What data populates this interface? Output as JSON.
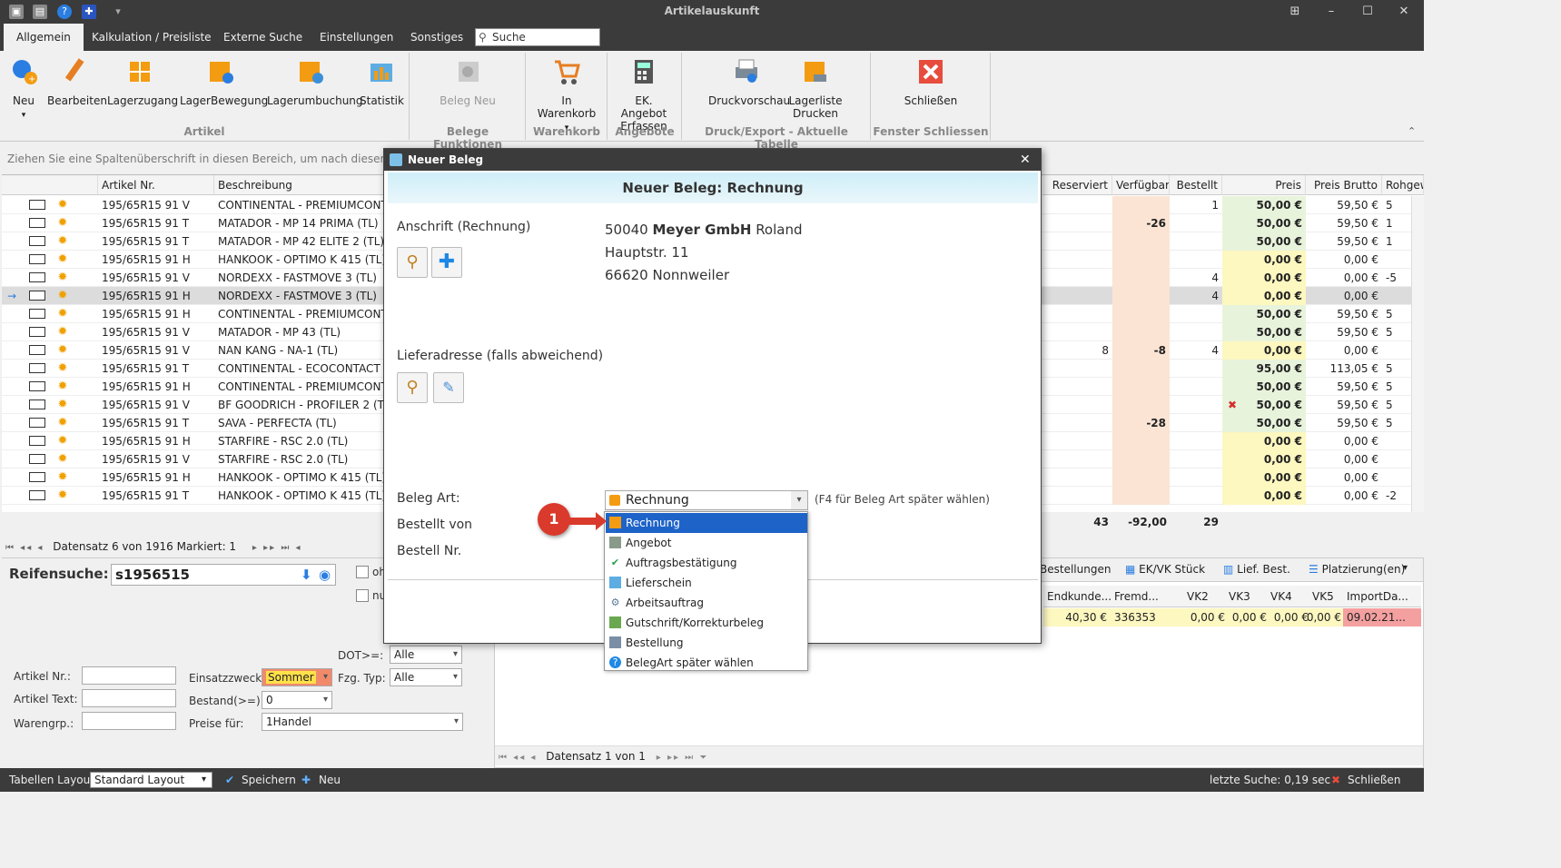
{
  "window": {
    "title": "Artikelauskunft"
  },
  "tabs": [
    "Allgemein",
    "Kalkulation / Preisliste",
    "Externe Suche",
    "Einstellungen",
    "Sonstiges"
  ],
  "search": {
    "label": "Suche"
  },
  "ribbon": {
    "buttons": [
      {
        "label": "Neu"
      },
      {
        "label": "Bearbeiten"
      },
      {
        "label": "Lagerzugang"
      },
      {
        "label": "LagerBewegung"
      },
      {
        "label": "Lagerumbuchung"
      },
      {
        "label": "Statistik"
      },
      {
        "label": "Beleg Neu"
      },
      {
        "label": "In Warenkorb"
      },
      {
        "label": "EK. Angebot Erfassen"
      },
      {
        "label": "Druckvorschau"
      },
      {
        "label": "Lagerliste Drucken"
      },
      {
        "label": "Schließen"
      }
    ],
    "groups": [
      "Artikel",
      "Belege Funktionen",
      "Warenkorb",
      "Angebote",
      "Druck/Export - Aktuelle Tabelle",
      "Fenster Schliessen"
    ]
  },
  "group_hint": "Ziehen Sie eine Spaltenüberschrift in diesen Bereich, um nach dieser zu gruppieren",
  "grid": {
    "columns": [
      "Artikel Nr.",
      "Beschreibung",
      "Reserviert",
      "Verfügbar",
      "Bestellt",
      "Preis",
      "Preis Brutto",
      "Rohgew"
    ],
    "rows": [
      {
        "nr": "195/65R15 91 V",
        "desc": "CONTINENTAL - PREMIUMCONTACT 6",
        "res": "",
        "verf": "",
        "best": "1",
        "preis": "50,00 €",
        "brutto": "59,50 €",
        "roh": "5"
      },
      {
        "nr": "195/65R15 91 T",
        "desc": "MATADOR - MP 14 PRIMA (TL)",
        "res": "",
        "verf": "-26",
        "best": "",
        "preis": "50,00 €",
        "brutto": "59,50 €",
        "roh": "1"
      },
      {
        "nr": "195/65R15 91 T",
        "desc": "MATADOR - MP 42 ELITE 2 (TL)",
        "res": "",
        "verf": "",
        "best": "",
        "preis": "50,00 €",
        "brutto": "59,50 €",
        "roh": "1"
      },
      {
        "nr": "195/65R15 91 H",
        "desc": "HANKOOK - OPTIMO K 415 (TL)",
        "res": "",
        "verf": "",
        "best": "",
        "preis": "0,00 €",
        "brutto": "0,00 €",
        "roh": ""
      },
      {
        "nr": "195/65R15 91 V",
        "desc": "NORDEXX - FASTMOVE 3 (TL)",
        "res": "",
        "verf": "",
        "best": "4",
        "preis": "0,00 €",
        "brutto": "0,00 €",
        "roh": "-5"
      },
      {
        "nr": "195/65R15 91 H",
        "desc": "NORDEXX - FASTMOVE 3 (TL)",
        "res": "",
        "verf": "",
        "best": "4",
        "preis": "0,00 €",
        "brutto": "0,00 €",
        "roh": ""
      },
      {
        "nr": "195/65R15 91 H",
        "desc": "CONTINENTAL - PREMIUMCONTACT 6",
        "res": "",
        "verf": "",
        "best": "",
        "preis": "50,00 €",
        "brutto": "59,50 €",
        "roh": "5"
      },
      {
        "nr": "195/65R15 91 V",
        "desc": "MATADOR - MP 43 (TL)",
        "res": "",
        "verf": "",
        "best": "",
        "preis": "50,00 €",
        "brutto": "59,50 €",
        "roh": "5"
      },
      {
        "nr": "195/65R15 91 V",
        "desc": "NAN KANG - NA-1 (TL)",
        "res": "8",
        "verf": "-8",
        "best": "4",
        "preis": "0,00 €",
        "brutto": "0,00 €",
        "roh": ""
      },
      {
        "nr": "195/65R15 91 T",
        "desc": "CONTINENTAL - ECOCONTACT 3 MO",
        "res": "",
        "verf": "",
        "best": "",
        "preis": "95,00 €",
        "brutto": "113,05 €",
        "roh": "5"
      },
      {
        "nr": "195/65R15 91 H",
        "desc": "CONTINENTAL - PREMIUMCONTACT 6",
        "res": "",
        "verf": "",
        "best": "",
        "preis": "50,00 €",
        "brutto": "59,50 €",
        "roh": "5"
      },
      {
        "nr": "195/65R15 91 V",
        "desc": "BF GOODRICH - PROFILER 2 (TL)",
        "res": "",
        "verf": "",
        "best": "",
        "preis": "50,00 €",
        "brutto": "59,50 €",
        "roh": "5"
      },
      {
        "nr": "195/65R15 91 T",
        "desc": "SAVA - PERFECTA (TL)",
        "res": "",
        "verf": "-28",
        "best": "",
        "preis": "50,00 €",
        "brutto": "59,50 €",
        "roh": "5"
      },
      {
        "nr": "195/65R15 91 H",
        "desc": "STARFIRE - RSC 2.0 (TL)",
        "res": "",
        "verf": "",
        "best": "",
        "preis": "0,00 €",
        "brutto": "0,00 €",
        "roh": ""
      },
      {
        "nr": "195/65R15 91 V",
        "desc": "STARFIRE - RSC 2.0 (TL)",
        "res": "",
        "verf": "",
        "best": "",
        "preis": "0,00 €",
        "brutto": "0,00 €",
        "roh": ""
      },
      {
        "nr": "195/65R15 91 H",
        "desc": "HANKOOK - OPTIMO K 415 (TL)",
        "res": "",
        "verf": "",
        "best": "",
        "preis": "0,00 €",
        "brutto": "0,00 €",
        "roh": ""
      },
      {
        "nr": "195/65R15 91 T",
        "desc": "HANKOOK - OPTIMO K 415 (TL)",
        "res": "",
        "verf": "",
        "best": "",
        "preis": "0,00 €",
        "brutto": "0,00 €",
        "roh": "-2"
      }
    ],
    "totals": {
      "res": "43",
      "verf": "-92,00",
      "best": "29"
    }
  },
  "navbar": {
    "text": "Datensatz 6 von 1916 Markiert: 1"
  },
  "left_panel": {
    "reifensuche_label": "Reifensuche:",
    "reifensuche_value": "s1956515",
    "dot_label": "DOT>=:",
    "dot_value": "Alle",
    "fzg_label": "Fzg. Typ:",
    "fzg_value": "Alle",
    "artikelnr_label": "Artikel Nr.:",
    "artikeltext_label": "Artikel Text:",
    "warengrp_label": "Warengrp.:",
    "einsatz_label": "Einsatzzweck:",
    "einsatz_value": "Sommer",
    "bestand_label": "Bestand(>=):",
    "bestand_value": "0",
    "preise_label": "Preise für:",
    "preise_value": "1Handel",
    "cb1": "oh",
    "cb2": "nu"
  },
  "right_panel": {
    "tabs": [
      "Bestellungen",
      "EK/VK Stück",
      "Lief. Best.",
      "Platzierung(en)"
    ],
    "columns": [
      "Endkunde...",
      "Fremd...",
      "VK2",
      "VK3",
      "VK4",
      "VK5",
      "ImportDa..."
    ],
    "row": [
      "40,30 €",
      "336353",
      "0,00 €",
      "0,00 €",
      "0,00 €",
      "0,00 €",
      "09.02.21..."
    ],
    "nav": "Datensatz 1 von 1"
  },
  "statusbar": {
    "layout_label": "Tabellen Layout:",
    "layout_value": "Standard Layout",
    "save": "Speichern",
    "new": "Neu",
    "last_search": "letzte Suche: 0,19 sec",
    "close": "Schließen"
  },
  "dialog": {
    "title": "Neuer Beleg",
    "header": "Neuer Beleg: Rechnung",
    "anschrift_label": "Anschrift (Rechnung)",
    "address_id": "50040",
    "address_company": "Meyer GmbH",
    "address_name": "Roland",
    "address_street": "Hauptstr. 11",
    "address_city": "66620 Nonnweiler",
    "liefer_label": "Lieferadresse (falls abweichend)",
    "belegart_label": "Beleg Art:",
    "belegart_value": "Rechnung",
    "belegart_hint": "(F4 für Beleg Art später wählen)",
    "bestellt_label": "Bestellt von",
    "bestellnr_label": "Bestell Nr."
  },
  "menu": {
    "items": [
      "Rechnung",
      "Angebot",
      "Auftragsbestätigung",
      "Lieferschein",
      "Arbeitsauftrag",
      "Gutschrift/Korrekturbeleg",
      "Bestellung",
      "BelegArt später wählen"
    ]
  },
  "badge": {
    "label": "1"
  },
  "colors": {
    "accent": "#1e63c8",
    "dark": "#3b3b3b",
    "yellow_cell": "#fdf7c0",
    "orange_cell": "#fbe4d4",
    "green_cell": "#e8f3dc",
    "badge": "#d93a2b"
  }
}
